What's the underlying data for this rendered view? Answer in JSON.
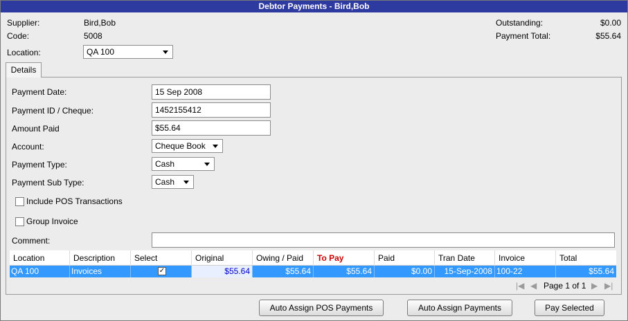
{
  "window": {
    "title": "Debtor Payments - Bird,Bob"
  },
  "header": {
    "supplier_label": "Supplier:",
    "supplier_value": "Bird,Bob",
    "code_label": "Code:",
    "code_value": "5008",
    "location_label": "Location:",
    "location_value": "QA 100",
    "outstanding_label": "Outstanding:",
    "outstanding_value": "$0.00",
    "payment_total_label": "Payment Total:",
    "payment_total_value": "$55.64"
  },
  "tabs": [
    {
      "label": "Details"
    }
  ],
  "form": {
    "payment_date_label": "Payment Date:",
    "payment_date_value": "15 Sep 2008",
    "payment_id_label": "Payment ID / Cheque:",
    "payment_id_value": "1452155412",
    "amount_paid_label": "Amount Paid",
    "amount_paid_value": "$55.64",
    "account_label": "Account:",
    "account_value": "Cheque Book",
    "payment_type_label": "Payment Type:",
    "payment_type_value": "Cash",
    "payment_subtype_label": "Payment Sub Type:",
    "payment_subtype_value": "Cash",
    "include_pos_label": "Include POS Transactions",
    "group_invoice_label": "Group Invoice",
    "comment_label": "Comment:",
    "comment_value": ""
  },
  "grid": {
    "columns": [
      "Location",
      "Description",
      "Select",
      "Original",
      "Owing / Paid",
      "To Pay",
      "Paid",
      "Tran Date",
      "Invoice",
      "Total"
    ],
    "rows": [
      {
        "location": "QA 100",
        "description": "Invoices",
        "select": "✓",
        "original": "$55.64",
        "owing_paid": "$55.64",
        "to_pay": "$55.64",
        "paid": "$0.00",
        "tran_date": "15-Sep-2008",
        "invoice": "100-22",
        "total": "$55.64"
      }
    ],
    "pager_text": "Page 1 of 1"
  },
  "buttons": {
    "auto_assign_pos": "Auto Assign POS Payments",
    "auto_assign": "Auto Assign Payments",
    "pay_selected": "Pay Selected"
  },
  "colors": {
    "titlebar": "#2d3aa0",
    "selected_row": "#3399ff",
    "to_pay_header": "#cc0000",
    "original_value": "#0000cc"
  }
}
